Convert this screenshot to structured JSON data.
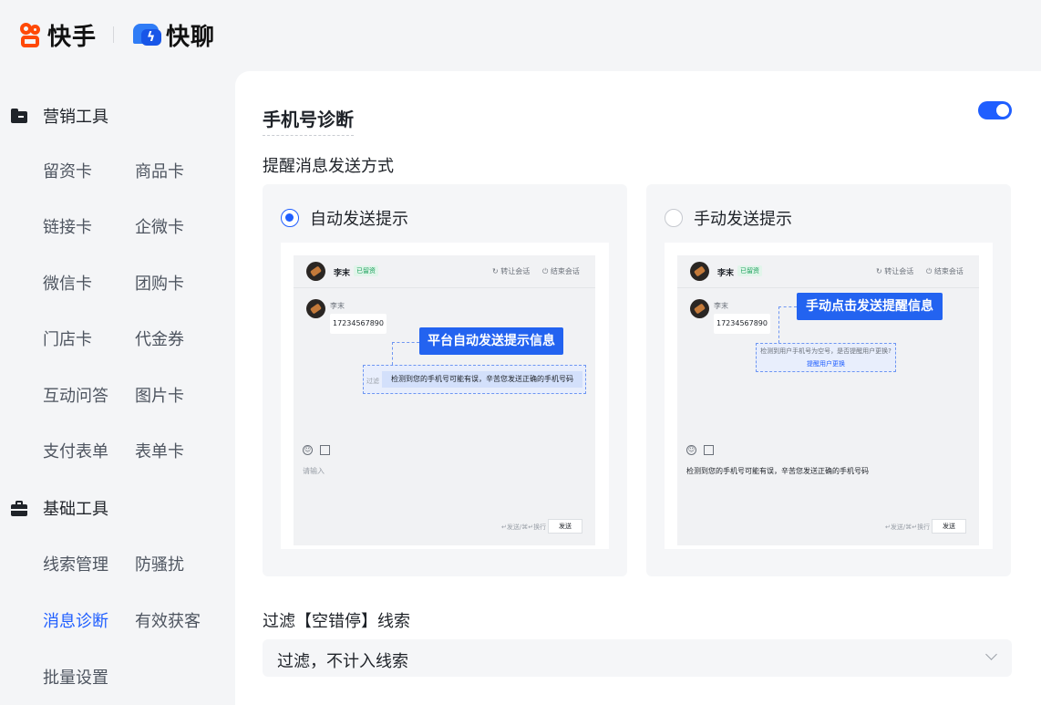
{
  "brand": {
    "kuaishou": "快手",
    "kuailiao": "快聊",
    "accent": "#1f5eff",
    "kuaishou_color": "#ff4906"
  },
  "sidebar": {
    "marketing": {
      "title": "营销工具",
      "icon": "folder-icon",
      "items": [
        "留资卡",
        "商品卡",
        "链接卡",
        "企微卡",
        "微信卡",
        "团购卡",
        "门店卡",
        "代金券",
        "互动问答",
        "图片卡",
        "支付表单",
        "表单卡"
      ]
    },
    "basic": {
      "title": "基础工具",
      "icon": "briefcase-icon",
      "items": [
        "线索管理",
        "防骚扰",
        "消息诊断",
        "有效获客",
        "批量设置"
      ],
      "active": "消息诊断"
    }
  },
  "main": {
    "title": "手机号诊断",
    "toggle_on": true,
    "send_mode_label": "提醒消息发送方式",
    "options": [
      {
        "label": "自动发送提示",
        "selected": true,
        "preview": {
          "contact": "李末",
          "tag": "已留资",
          "transfer": "转让会话",
          "end": "结束会话",
          "sender": "李末",
          "phone": "17234567890",
          "callout": "平台自动发送提示信息",
          "filter_tag": "过滤",
          "system_msg": "检测到您的手机号可能有误，辛苦您发送正确的手机号码",
          "input_placeholder": "请输入",
          "send_hint": "↵发送/⌘↵换行",
          "send": "发送"
        }
      },
      {
        "label": "手动发送提示",
        "selected": false,
        "preview": {
          "contact": "李末",
          "tag": "已留资",
          "transfer": "转让会话",
          "end": "结束会话",
          "sender": "李末",
          "phone": "17234567890",
          "callout": "手动点击发送提醒信息",
          "system_msg_line1": "检测到用户手机号为空号，是否提醒用户更换?",
          "system_msg_line2": "提醒用户更换",
          "input_text": "检测到您的手机号可能有误，辛苦您发送正确的手机号码",
          "send_hint": "↵发送/⌘↵换行",
          "send": "发送"
        }
      }
    ],
    "filter": {
      "label": "过滤【空错停】线索",
      "value": "过滤，不计入线索"
    }
  }
}
